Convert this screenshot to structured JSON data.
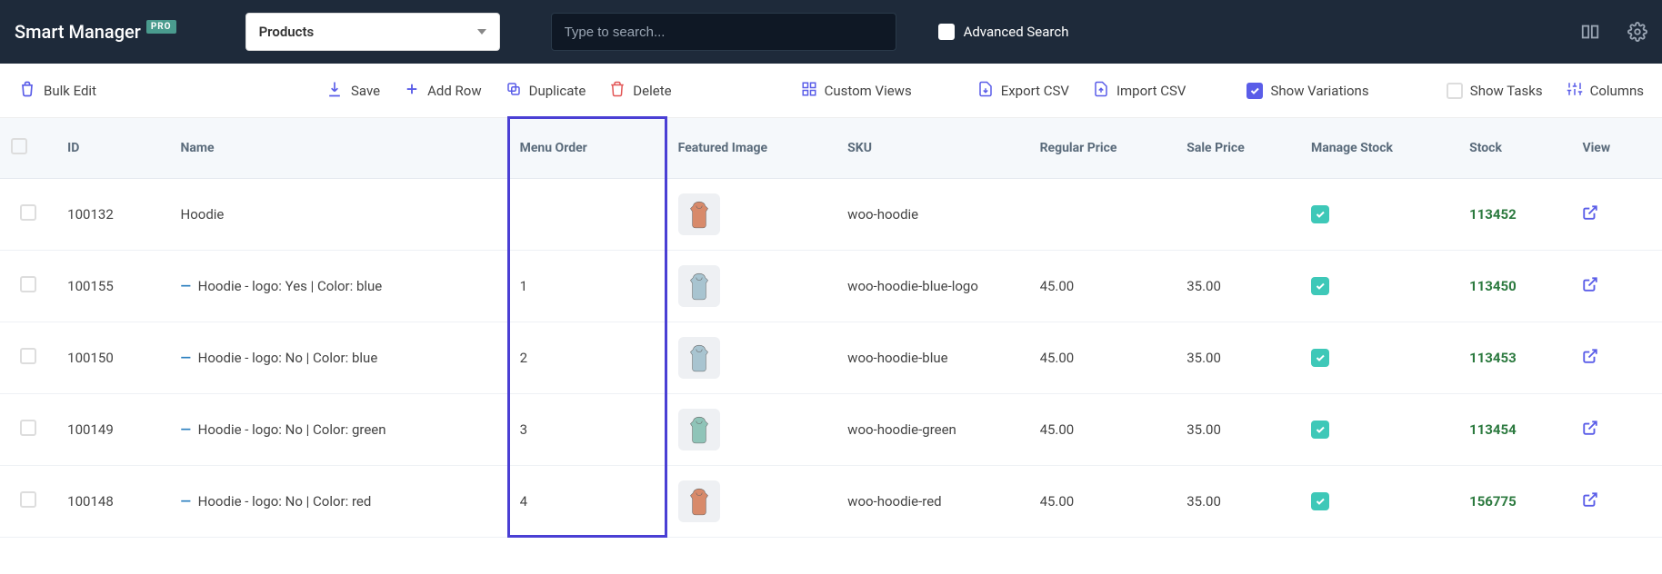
{
  "header": {
    "brand": "Smart Manager",
    "badge": "PRO",
    "dashboard_selected": "Products",
    "search_placeholder": "Type to search...",
    "advanced_search": "Advanced Search"
  },
  "toolbar": {
    "bulk_edit": "Bulk Edit",
    "save": "Save",
    "add_row": "Add Row",
    "duplicate": "Duplicate",
    "delete": "Delete",
    "custom_views": "Custom Views",
    "export_csv": "Export CSV",
    "import_csv": "Import CSV",
    "show_variations": "Show Variations",
    "show_variations_checked": true,
    "show_tasks": "Show Tasks",
    "columns": "Columns"
  },
  "columns": {
    "id": "ID",
    "name": "Name",
    "menu_order": "Menu Order",
    "featured_image": "Featured Image",
    "sku": "SKU",
    "regular_price": "Regular Price",
    "sale_price": "Sale Price",
    "manage_stock": "Manage Stock",
    "stock": "Stock",
    "view": "View"
  },
  "rows": [
    {
      "id": "100132",
      "name": "Hoodie",
      "menu_order": "",
      "sku": "woo-hoodie",
      "regular_price": "",
      "sale_price": "",
      "manage_stock": true,
      "stock": "113452",
      "is_variation": false,
      "thumb_color": "#d88a6a"
    },
    {
      "id": "100155",
      "name": "Hoodie - logo: Yes | Color: blue",
      "menu_order": "1",
      "sku": "woo-hoodie-blue-logo",
      "regular_price": "45.00",
      "sale_price": "35.00",
      "manage_stock": true,
      "stock": "113450",
      "is_variation": true,
      "thumb_color": "#a8c4d0"
    },
    {
      "id": "100150",
      "name": "Hoodie - logo: No | Color: blue",
      "menu_order": "2",
      "sku": "woo-hoodie-blue",
      "regular_price": "45.00",
      "sale_price": "35.00",
      "manage_stock": true,
      "stock": "113453",
      "is_variation": true,
      "thumb_color": "#a8c4d0"
    },
    {
      "id": "100149",
      "name": "Hoodie - logo: No | Color: green",
      "menu_order": "3",
      "sku": "woo-hoodie-green",
      "regular_price": "45.00",
      "sale_price": "35.00",
      "manage_stock": true,
      "stock": "113454",
      "is_variation": true,
      "thumb_color": "#8fc4b8"
    },
    {
      "id": "100148",
      "name": "Hoodie - logo: No | Color: red",
      "menu_order": "4",
      "sku": "woo-hoodie-red",
      "regular_price": "45.00",
      "sale_price": "35.00",
      "manage_stock": true,
      "stock": "156775",
      "is_variation": true,
      "thumb_color": "#d88a6a"
    }
  ],
  "highlight_column": "menu_order"
}
